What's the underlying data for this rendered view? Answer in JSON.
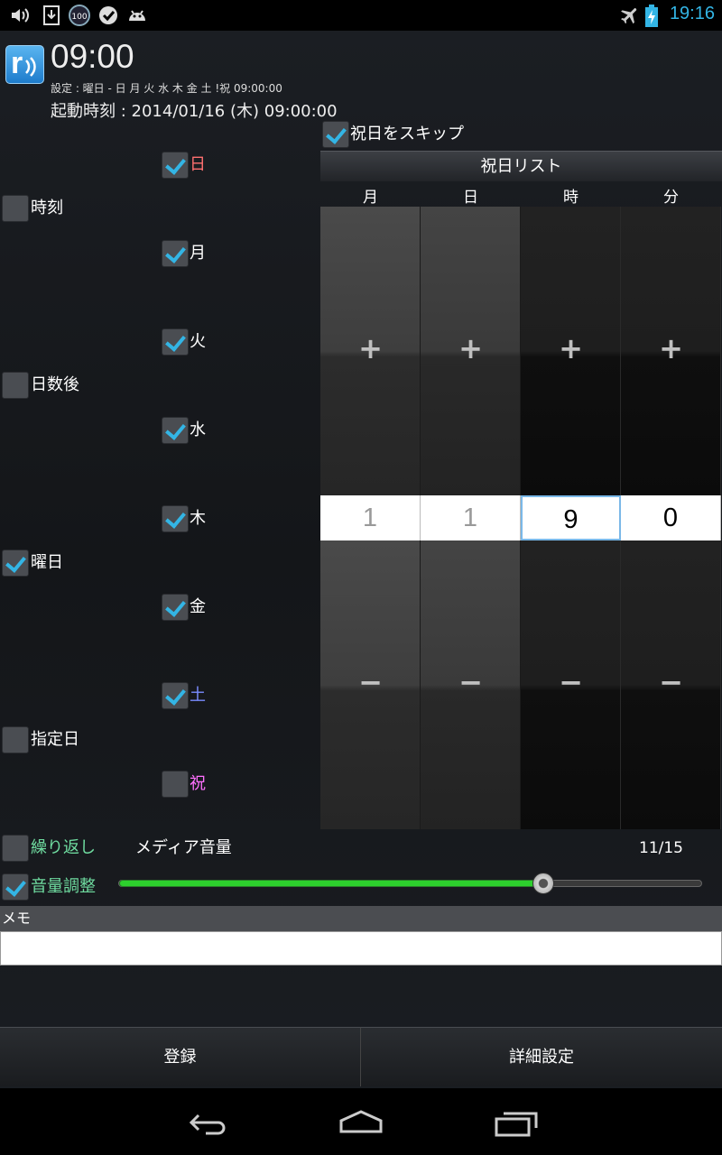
{
  "status_bar": {
    "time": "19:16",
    "left_icons": [
      "volume-icon",
      "download-icon",
      "battery-100-badge-icon",
      "check-badge-icon",
      "android-icon"
    ],
    "battery_badge": "100",
    "right_icons": [
      "airplane-mode-icon",
      "battery-charging-icon"
    ]
  },
  "header": {
    "logo_letter": "r",
    "time": "09:00",
    "setting": "設定 : 曜日 - 日 月 火 水 木 金 土 !祝  09:00:00",
    "start_time": "起動時刻 : 2014/01/16 (木) 09:00:00"
  },
  "modes": [
    {
      "label": "時刻",
      "checked": false
    },
    {
      "label": "日数後",
      "checked": false
    },
    {
      "label": "曜日",
      "checked": true
    },
    {
      "label": "指定日",
      "checked": false
    }
  ],
  "weekdays": [
    {
      "label": "日",
      "checked": true,
      "color": "#ff7070"
    },
    {
      "label": "月",
      "checked": true,
      "color": "#ffffff"
    },
    {
      "label": "火",
      "checked": true,
      "color": "#ffffff"
    },
    {
      "label": "水",
      "checked": true,
      "color": "#ffffff"
    },
    {
      "label": "木",
      "checked": true,
      "color": "#ffffff"
    },
    {
      "label": "金",
      "checked": true,
      "color": "#ffffff"
    },
    {
      "label": "土",
      "checked": true,
      "color": "#7a8cff"
    },
    {
      "label": "祝",
      "checked": false,
      "color": "#ff70ff"
    }
  ],
  "skip_holidays": {
    "label": "祝日をスキップ",
    "checked": true
  },
  "holiday_list_button": "祝日リスト",
  "picker": {
    "plus": "+",
    "minus": "−",
    "columns": [
      {
        "header": "月",
        "value": "1"
      },
      {
        "header": "日",
        "value": "1"
      },
      {
        "header": "時",
        "value": "9"
      },
      {
        "header": "分",
        "value": "0"
      }
    ]
  },
  "repeat": {
    "label": "繰り返し",
    "checked": false,
    "color": "#6fdca0"
  },
  "volume_adjust": {
    "label": "音量調整",
    "checked": true,
    "color": "#6fdca0"
  },
  "media_volume": {
    "label": "メディア音量",
    "value_text": "11/15",
    "level": 11,
    "max": 15
  },
  "memo": {
    "label": "メモ",
    "value": ""
  },
  "buttons": {
    "register": "登録",
    "details": "詳細設定"
  },
  "nav": [
    "back-icon",
    "home-icon",
    "recent-apps-icon"
  ]
}
